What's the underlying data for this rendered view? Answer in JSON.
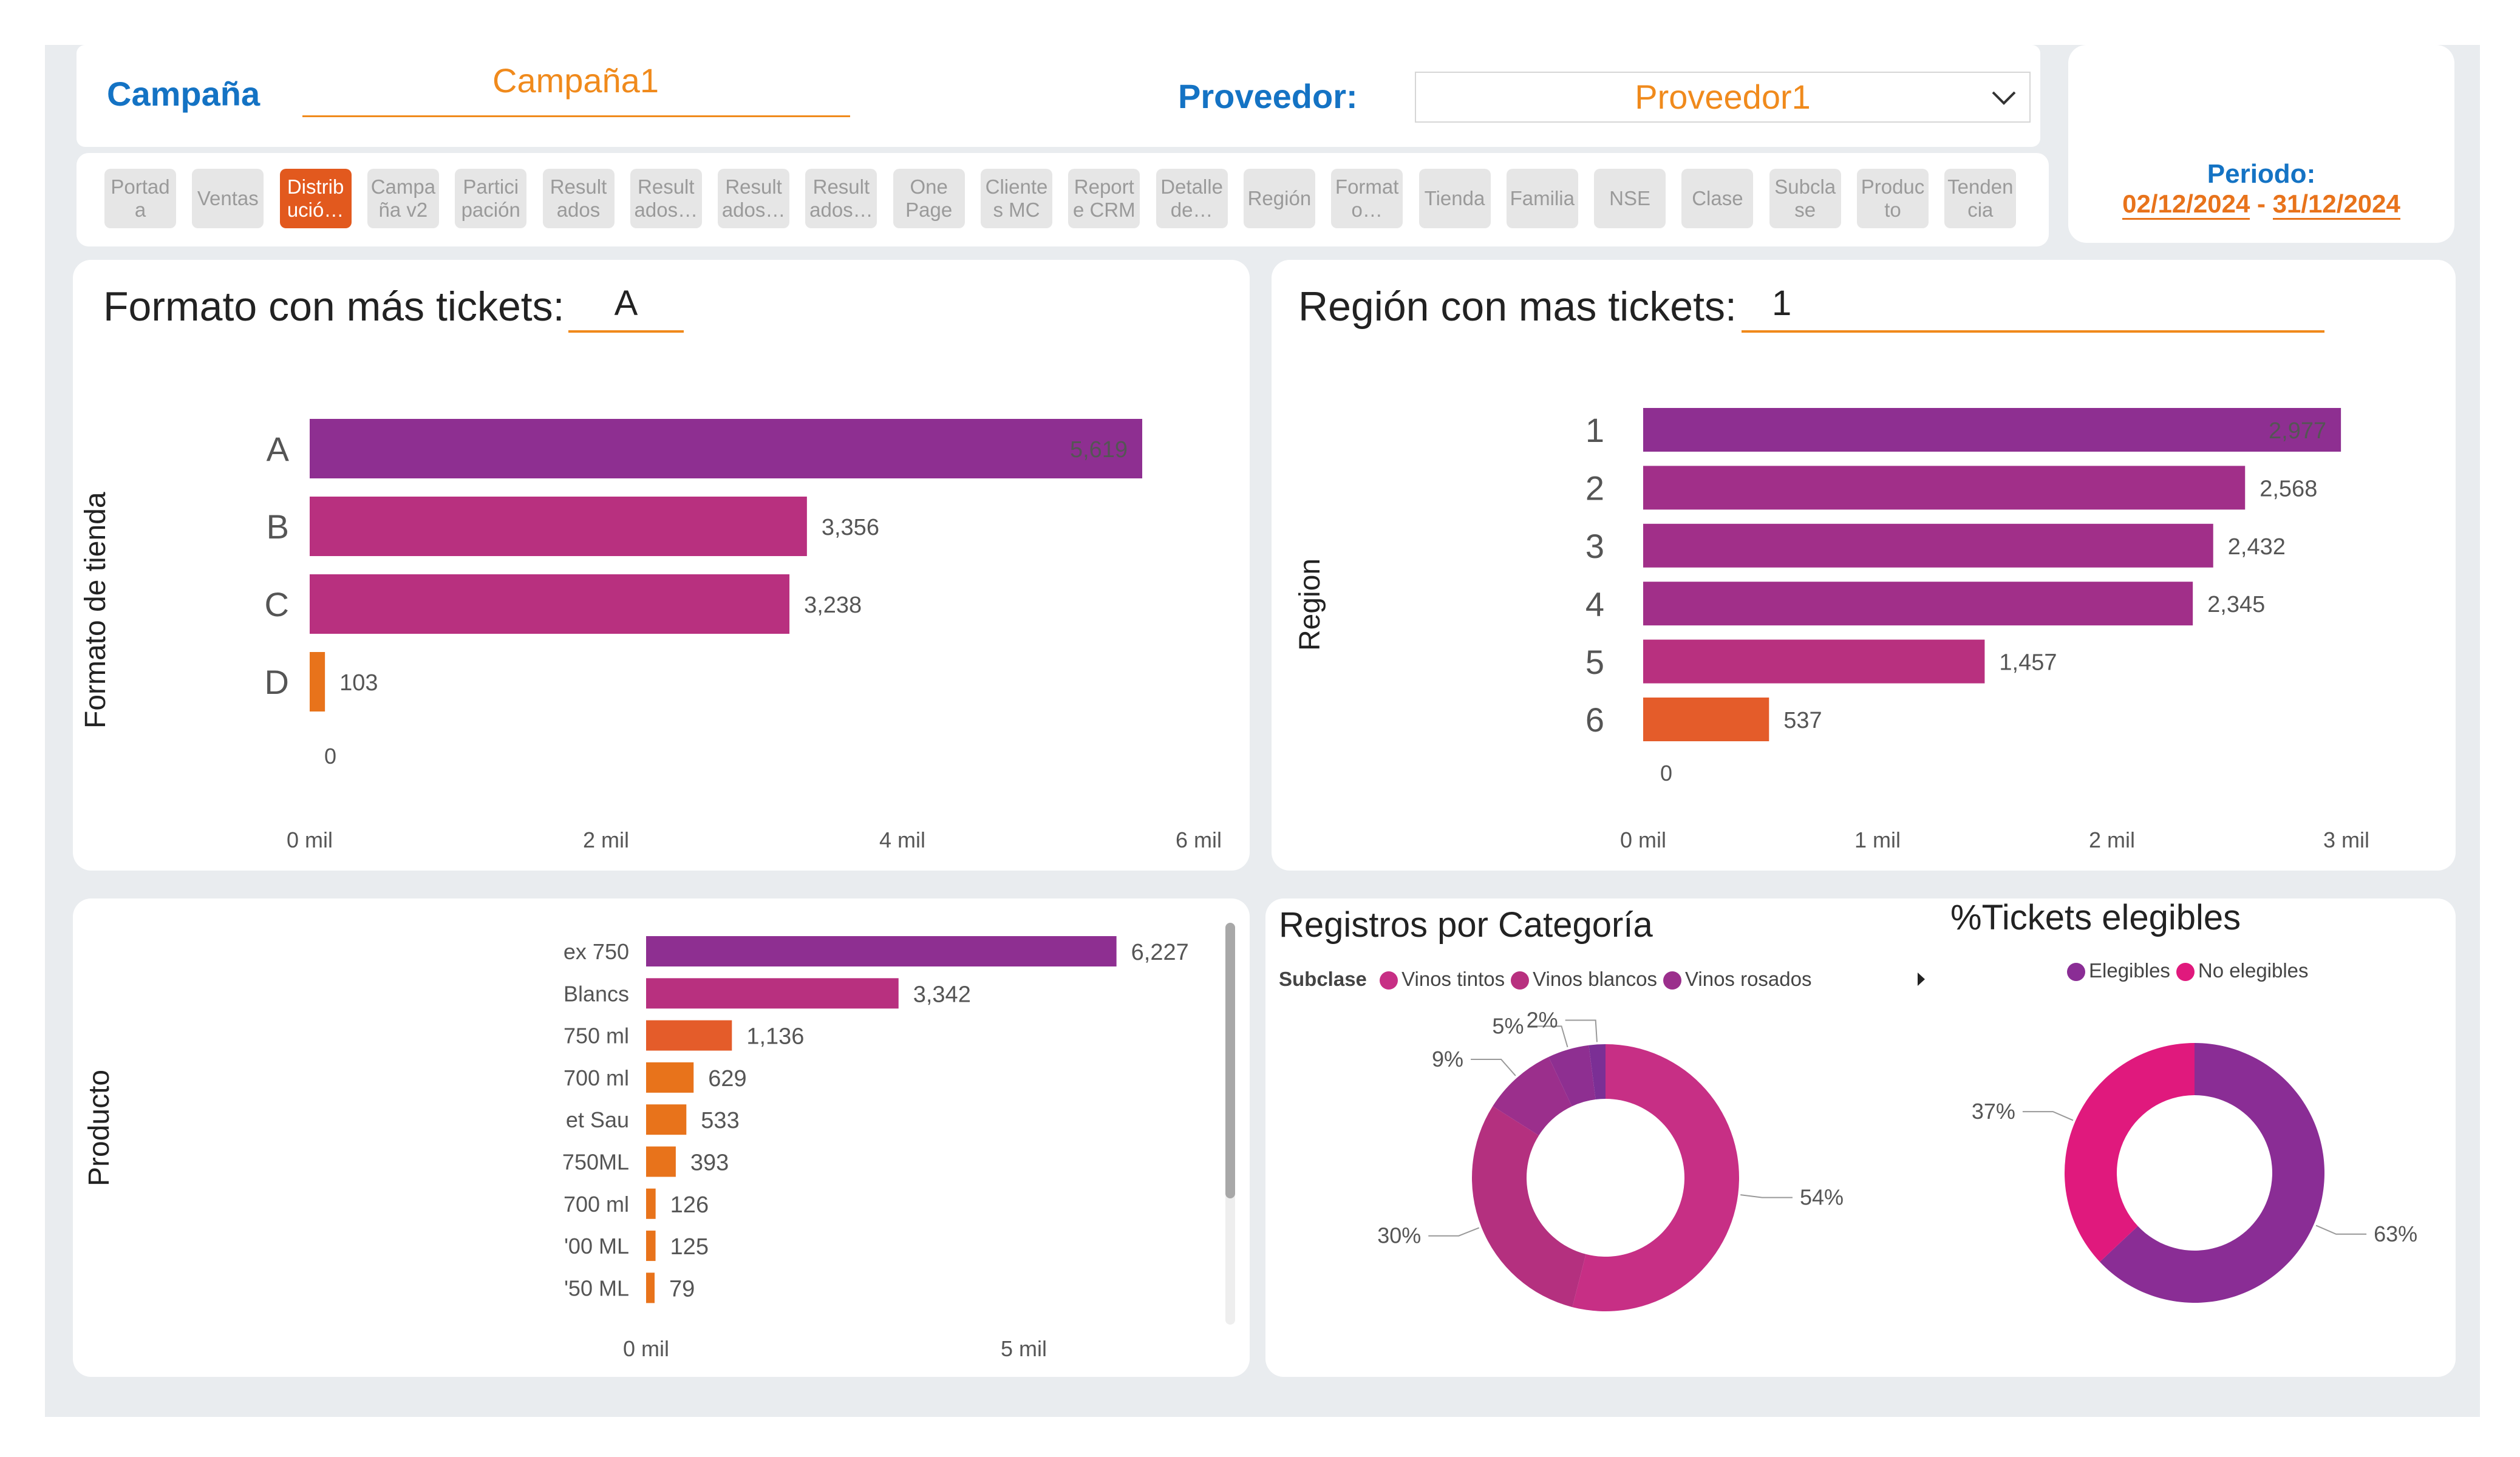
{
  "header": {
    "campaign_label": "Campaña",
    "campaign_value": "Campaña1",
    "provider_label": "Proveedor:",
    "provider_value": "Proveedor1",
    "period_label": "Periodo:",
    "period_start": "02/12/2024",
    "period_sep": "-",
    "period_end": "31/12/2024"
  },
  "nav": [
    {
      "label": "Portad\na",
      "active": false
    },
    {
      "label": "Ventas",
      "active": false
    },
    {
      "label": "Distrib\nució…",
      "active": true
    },
    {
      "label": "Campa\nña v2",
      "active": false
    },
    {
      "label": "Partici\npación",
      "active": false
    },
    {
      "label": "Result\nados",
      "active": false
    },
    {
      "label": "Result\nados…",
      "active": false
    },
    {
      "label": "Result\nados…",
      "active": false
    },
    {
      "label": "Result\nados…",
      "active": false
    },
    {
      "label": "One\nPage",
      "active": false
    },
    {
      "label": "Cliente\ns MC",
      "active": false
    },
    {
      "label": "Report\ne CRM",
      "active": false
    },
    {
      "label": "Detalle\nde…",
      "active": false
    },
    {
      "label": "Región",
      "active": false
    },
    {
      "label": "Format\no…",
      "active": false
    },
    {
      "label": "Tienda",
      "active": false
    },
    {
      "label": "Familia",
      "active": false
    },
    {
      "label": "NSE",
      "active": false
    },
    {
      "label": "Clase",
      "active": false
    },
    {
      "label": "Subcla\nse",
      "active": false
    },
    {
      "label": "Produc\nto",
      "active": false
    },
    {
      "label": "Tenden\ncia",
      "active": false
    }
  ],
  "formato_card": {
    "title": "Formato con más tickets:",
    "value": "A",
    "axis_title": "Formato de tienda"
  },
  "region_card": {
    "title": "Región con mas tickets:",
    "value": "1",
    "axis_title": "Region"
  },
  "producto_card": {
    "axis_title": "Producto"
  },
  "categoria_card": {
    "title": "Registros por Categoría",
    "legend_title": "Subclase"
  },
  "tickets_card": {
    "title": "%Tickets elegibles"
  },
  "chart_data": [
    {
      "type": "bar",
      "orientation": "horizontal",
      "categories": [
        "A",
        "B",
        "C",
        "D"
      ],
      "values": [
        5619,
        3356,
        3238,
        103
      ],
      "value_labels": [
        "5,619",
        "3,356",
        "3,238",
        "103"
      ],
      "colors": [
        "#8e2f91",
        "#b8307f",
        "#b8307f",
        "#e8731b"
      ],
      "extra_tick": "0",
      "ylabel": "Formato de tienda",
      "xticks": [
        "0 mil",
        "2 mil",
        "4 mil",
        "6 mil"
      ],
      "xlim": [
        0,
        6000
      ]
    },
    {
      "type": "bar",
      "orientation": "horizontal",
      "categories": [
        "1",
        "2",
        "3",
        "4",
        "5",
        "6"
      ],
      "values": [
        2977,
        2568,
        2432,
        2345,
        1457,
        537
      ],
      "value_labels": [
        "2,977",
        "2,568",
        "2,432",
        "2,345",
        "1,457",
        "537"
      ],
      "colors": [
        "#8e2f91",
        "#a12f89",
        "#a12f89",
        "#a12f89",
        "#b8307f",
        "#e45c2a"
      ],
      "extra_tick": "0",
      "ylabel": "Region",
      "xticks": [
        "0 mil",
        "1 mil",
        "2 mil",
        "3 mil"
      ],
      "xlim": [
        0,
        3000
      ]
    },
    {
      "type": "bar",
      "orientation": "horizontal",
      "categories": [
        "ex 750",
        "Blancs",
        "750 ml",
        "700 ml",
        "et Sau",
        "750ML",
        "700 ml",
        "'00 ML",
        "'50 ML"
      ],
      "values": [
        6227,
        3342,
        1136,
        629,
        533,
        393,
        126,
        125,
        79
      ],
      "value_labels": [
        "6,227",
        "3,342",
        "1,136",
        "629",
        "533",
        "393",
        "126",
        "125",
        "79"
      ],
      "colors": [
        "#8e2f91",
        "#b8307f",
        "#e45c2a",
        "#e8731b",
        "#e8731b",
        "#e8731b",
        "#e8731b",
        "#e8731b",
        "#e8731b"
      ],
      "ylabel": "Producto",
      "xticks": [
        "0 mil",
        "5 mil"
      ],
      "xlim": [
        0,
        10000
      ]
    },
    {
      "type": "pie",
      "title": "Registros por Categoría",
      "legend_title": "Subclase",
      "legend": [
        "Vinos tintos",
        "Vinos blancos",
        "Vinos rosados"
      ],
      "legend_colors": [
        "#c72f85",
        "#b8307f",
        "#9b2f8c"
      ],
      "values": [
        54,
        30,
        9,
        5,
        2
      ],
      "labels": [
        "54%",
        "30%",
        "9%",
        "5%",
        "2%"
      ],
      "colors": [
        "#c72f85",
        "#b4307f",
        "#9b2f8c",
        "#8e2f91",
        "#7b2f95"
      ]
    },
    {
      "type": "pie",
      "title": "%Tickets elegibles",
      "legend": [
        "Elegibles",
        "No elegibles"
      ],
      "values": [
        63,
        37
      ],
      "labels": [
        "63%",
        "37%"
      ],
      "colors": [
        "#8a2d95",
        "#e0197d"
      ]
    }
  ]
}
